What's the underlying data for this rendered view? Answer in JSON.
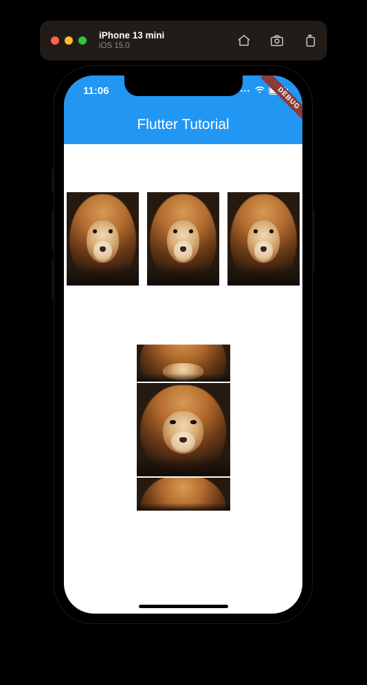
{
  "simulator": {
    "device_name": "iPhone 13 mini",
    "ios_version": "iOS 15.0",
    "icons": [
      "home",
      "screenshot",
      "copy"
    ]
  },
  "status_bar": {
    "time": "11:06",
    "battery_pct": 100
  },
  "app": {
    "title": "Flutter Tutorial",
    "debug_banner": "DEBUG"
  },
  "content": {
    "row_image_count": 3,
    "column_image_count": 3,
    "image_name": "lion"
  },
  "colors": {
    "accent": "#2196f3",
    "simulator_chrome": "#211c18"
  }
}
